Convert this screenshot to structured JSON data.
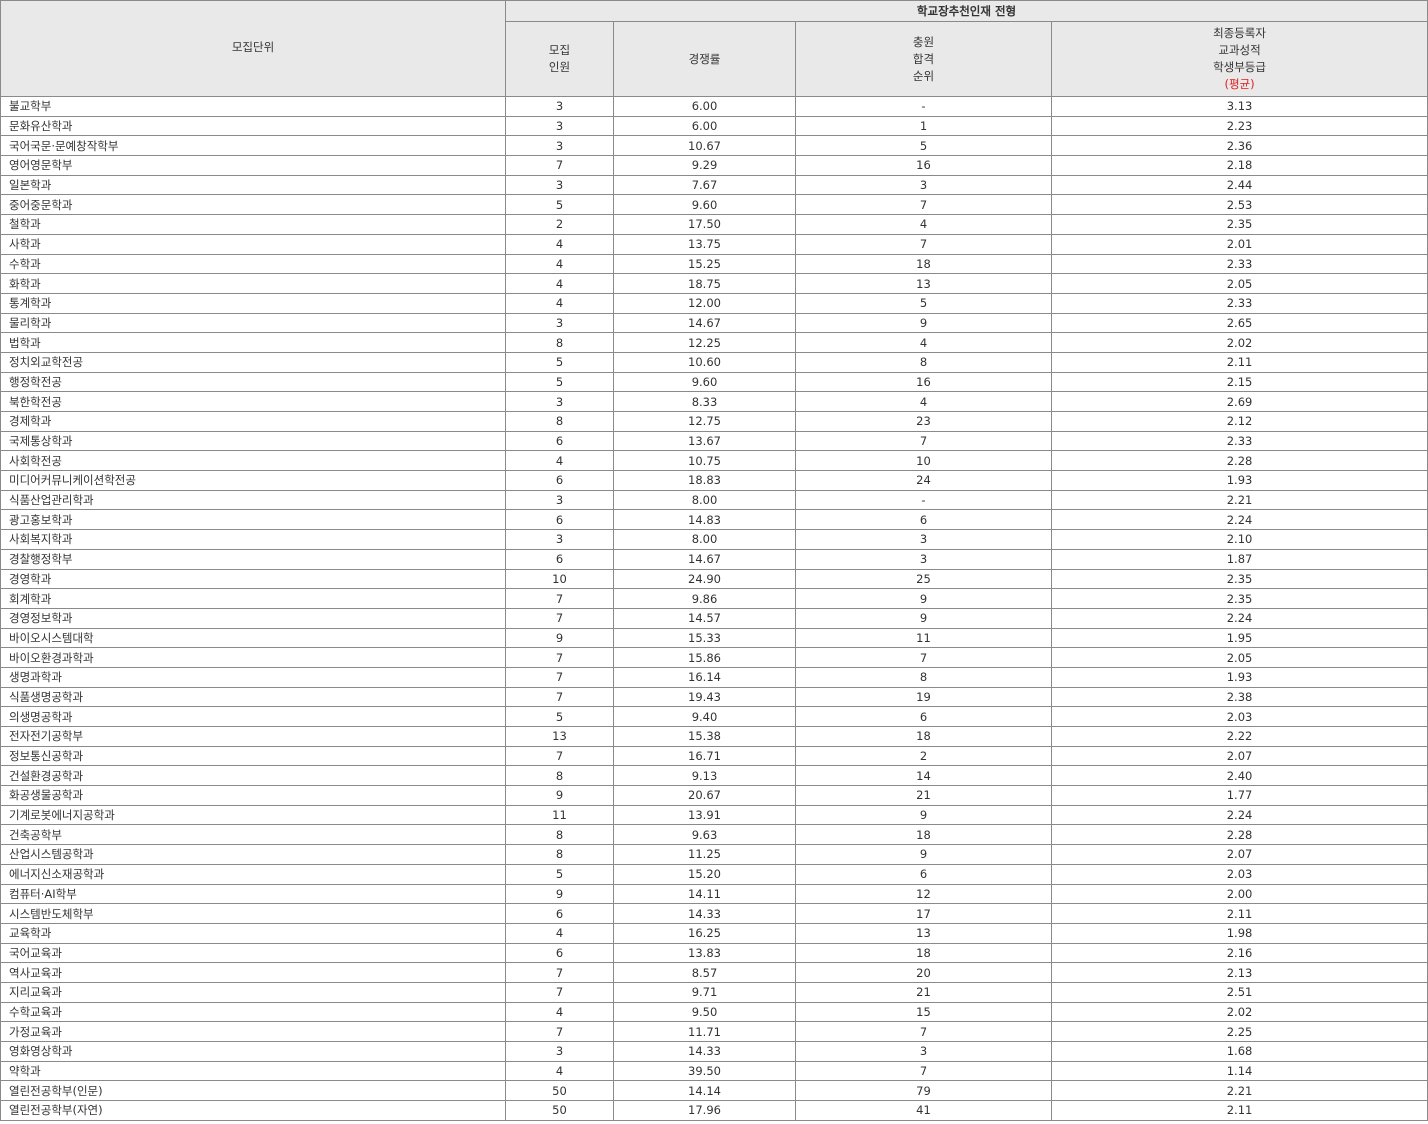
{
  "header": {
    "unit": "모집단위",
    "group": "학교장추천인재 전형",
    "quota": [
      "모집",
      "인원"
    ],
    "ratio": "경쟁률",
    "waitlist": [
      "충원",
      "합격",
      "순위"
    ],
    "grade": [
      "최종등록자",
      "교과성적",
      "학생부등급"
    ],
    "grade_avg": "(평균)"
  },
  "colors": {
    "avg_label": "#e02020",
    "header_bg": "#e9e9e9",
    "border": "#8a8a8a"
  },
  "rows": [
    {
      "name": "불교학부",
      "quota": "3",
      "ratio": "6.00",
      "waitlist": "-",
      "grade": "3.13"
    },
    {
      "name": "문화유산학과",
      "quota": "3",
      "ratio": "6.00",
      "waitlist": "1",
      "grade": "2.23"
    },
    {
      "name": "국어국문·문예창작학부",
      "quota": "3",
      "ratio": "10.67",
      "waitlist": "5",
      "grade": "2.36"
    },
    {
      "name": "영어영문학부",
      "quota": "7",
      "ratio": "9.29",
      "waitlist": "16",
      "grade": "2.18"
    },
    {
      "name": "일본학과",
      "quota": "3",
      "ratio": "7.67",
      "waitlist": "3",
      "grade": "2.44"
    },
    {
      "name": "중어중문학과",
      "quota": "5",
      "ratio": "9.60",
      "waitlist": "7",
      "grade": "2.53"
    },
    {
      "name": "철학과",
      "quota": "2",
      "ratio": "17.50",
      "waitlist": "4",
      "grade": "2.35"
    },
    {
      "name": "사학과",
      "quota": "4",
      "ratio": "13.75",
      "waitlist": "7",
      "grade": "2.01"
    },
    {
      "name": "수학과",
      "quota": "4",
      "ratio": "15.25",
      "waitlist": "18",
      "grade": "2.33"
    },
    {
      "name": "화학과",
      "quota": "4",
      "ratio": "18.75",
      "waitlist": "13",
      "grade": "2.05"
    },
    {
      "name": "통계학과",
      "quota": "4",
      "ratio": "12.00",
      "waitlist": "5",
      "grade": "2.33"
    },
    {
      "name": "물리학과",
      "quota": "3",
      "ratio": "14.67",
      "waitlist": "9",
      "grade": "2.65"
    },
    {
      "name": "법학과",
      "quota": "8",
      "ratio": "12.25",
      "waitlist": "4",
      "grade": "2.02"
    },
    {
      "name": "정치외교학전공",
      "quota": "5",
      "ratio": "10.60",
      "waitlist": "8",
      "grade": "2.11"
    },
    {
      "name": "행정학전공",
      "quota": "5",
      "ratio": "9.60",
      "waitlist": "16",
      "grade": "2.15"
    },
    {
      "name": "북한학전공",
      "quota": "3",
      "ratio": "8.33",
      "waitlist": "4",
      "grade": "2.69"
    },
    {
      "name": "경제학과",
      "quota": "8",
      "ratio": "12.75",
      "waitlist": "23",
      "grade": "2.12"
    },
    {
      "name": "국제통상학과",
      "quota": "6",
      "ratio": "13.67",
      "waitlist": "7",
      "grade": "2.33"
    },
    {
      "name": "사회학전공",
      "quota": "4",
      "ratio": "10.75",
      "waitlist": "10",
      "grade": "2.28"
    },
    {
      "name": "미디어커뮤니케이션학전공",
      "quota": "6",
      "ratio": "18.83",
      "waitlist": "24",
      "grade": "1.93"
    },
    {
      "name": "식품산업관리학과",
      "quota": "3",
      "ratio": "8.00",
      "waitlist": "-",
      "grade": "2.21"
    },
    {
      "name": "광고홍보학과",
      "quota": "6",
      "ratio": "14.83",
      "waitlist": "6",
      "grade": "2.24"
    },
    {
      "name": "사회복지학과",
      "quota": "3",
      "ratio": "8.00",
      "waitlist": "3",
      "grade": "2.10"
    },
    {
      "name": "경찰행정학부",
      "quota": "6",
      "ratio": "14.67",
      "waitlist": "3",
      "grade": "1.87"
    },
    {
      "name": "경영학과",
      "quota": "10",
      "ratio": "24.90",
      "waitlist": "25",
      "grade": "2.35"
    },
    {
      "name": "회계학과",
      "quota": "7",
      "ratio": "9.86",
      "waitlist": "9",
      "grade": "2.35"
    },
    {
      "name": "경영정보학과",
      "quota": "7",
      "ratio": "14.57",
      "waitlist": "9",
      "grade": "2.24"
    },
    {
      "name": "바이오시스템대학",
      "quota": "9",
      "ratio": "15.33",
      "waitlist": "11",
      "grade": "1.95"
    },
    {
      "name": "바이오환경과학과",
      "quota": "7",
      "ratio": "15.86",
      "waitlist": "7",
      "grade": "2.05"
    },
    {
      "name": "생명과학과",
      "quota": "7",
      "ratio": "16.14",
      "waitlist": "8",
      "grade": "1.93"
    },
    {
      "name": "식품생명공학과",
      "quota": "7",
      "ratio": "19.43",
      "waitlist": "19",
      "grade": "2.38"
    },
    {
      "name": "의생명공학과",
      "quota": "5",
      "ratio": "9.40",
      "waitlist": "6",
      "grade": "2.03"
    },
    {
      "name": "전자전기공학부",
      "quota": "13",
      "ratio": "15.38",
      "waitlist": "18",
      "grade": "2.22"
    },
    {
      "name": "정보통신공학과",
      "quota": "7",
      "ratio": "16.71",
      "waitlist": "2",
      "grade": "2.07"
    },
    {
      "name": "건설환경공학과",
      "quota": "8",
      "ratio": "9.13",
      "waitlist": "14",
      "grade": "2.40"
    },
    {
      "name": "화공생물공학과",
      "quota": "9",
      "ratio": "20.67",
      "waitlist": "21",
      "grade": "1.77"
    },
    {
      "name": "기계로봇에너지공학과",
      "quota": "11",
      "ratio": "13.91",
      "waitlist": "9",
      "grade": "2.24"
    },
    {
      "name": "건축공학부",
      "quota": "8",
      "ratio": "9.63",
      "waitlist": "18",
      "grade": "2.28"
    },
    {
      "name": "산업시스템공학과",
      "quota": "8",
      "ratio": "11.25",
      "waitlist": "9",
      "grade": "2.07"
    },
    {
      "name": "에너지신소재공학과",
      "quota": "5",
      "ratio": "15.20",
      "waitlist": "6",
      "grade": "2.03"
    },
    {
      "name": "컴퓨터·AI학부",
      "quota": "9",
      "ratio": "14.11",
      "waitlist": "12",
      "grade": "2.00"
    },
    {
      "name": "시스템반도체학부",
      "quota": "6",
      "ratio": "14.33",
      "waitlist": "17",
      "grade": "2.11"
    },
    {
      "name": "교육학과",
      "quota": "4",
      "ratio": "16.25",
      "waitlist": "13",
      "grade": "1.98"
    },
    {
      "name": "국어교육과",
      "quota": "6",
      "ratio": "13.83",
      "waitlist": "18",
      "grade": "2.16"
    },
    {
      "name": "역사교육과",
      "quota": "7",
      "ratio": "8.57",
      "waitlist": "20",
      "grade": "2.13"
    },
    {
      "name": "지리교육과",
      "quota": "7",
      "ratio": "9.71",
      "waitlist": "21",
      "grade": "2.51"
    },
    {
      "name": "수학교육과",
      "quota": "4",
      "ratio": "9.50",
      "waitlist": "15",
      "grade": "2.02"
    },
    {
      "name": "가정교육과",
      "quota": "7",
      "ratio": "11.71",
      "waitlist": "7",
      "grade": "2.25"
    },
    {
      "name": "영화영상학과",
      "quota": "3",
      "ratio": "14.33",
      "waitlist": "3",
      "grade": "1.68"
    },
    {
      "name": "약학과",
      "quota": "4",
      "ratio": "39.50",
      "waitlist": "7",
      "grade": "1.14"
    },
    {
      "name": "열린전공학부(인문)",
      "quota": "50",
      "ratio": "14.14",
      "waitlist": "79",
      "grade": "2.21"
    },
    {
      "name": "열린전공학부(자연)",
      "quota": "50",
      "ratio": "17.96",
      "waitlist": "41",
      "grade": "2.11"
    }
  ]
}
